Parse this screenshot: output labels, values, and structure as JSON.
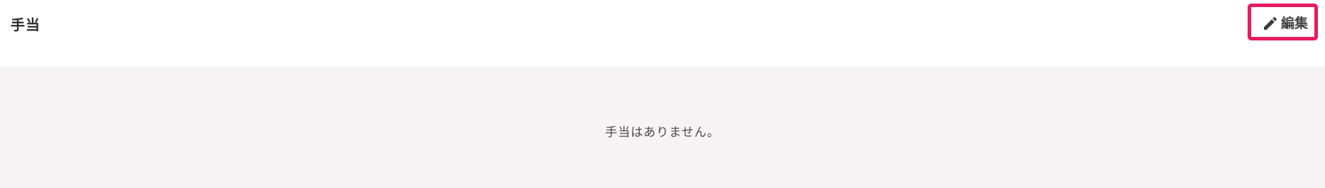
{
  "section": {
    "title": "手当",
    "edit_label": "編集",
    "edit_icon": "pencil-icon",
    "empty_message": "手当はありません。"
  },
  "colors": {
    "highlight": "#e8195f",
    "content_background": "#f5f3f4"
  }
}
